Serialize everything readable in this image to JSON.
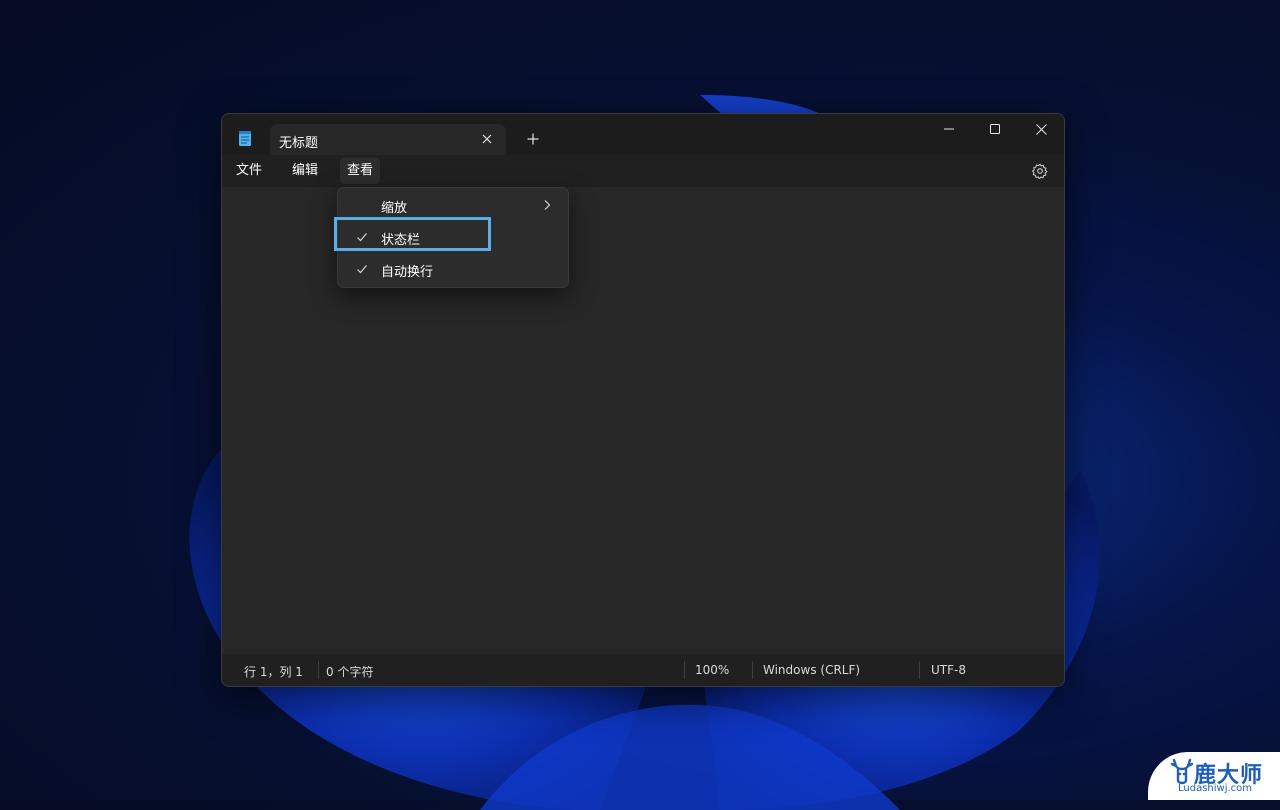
{
  "window": {
    "tab_title": "无标题",
    "icons": {
      "app": "notepad-icon",
      "tab_close": "close-icon",
      "new_tab": "plus-icon",
      "minimize": "minimize-icon",
      "maximize": "maximize-icon",
      "close": "close-icon",
      "settings": "gear-icon"
    }
  },
  "menubar": {
    "items": [
      {
        "label": "文件"
      },
      {
        "label": "编辑"
      },
      {
        "label": "查看",
        "active": true
      }
    ]
  },
  "view_menu": {
    "items": [
      {
        "label": "缩放",
        "checked": false,
        "submenu": true
      },
      {
        "label": "状态栏",
        "checked": true,
        "highlighted": true
      },
      {
        "label": "自动换行",
        "checked": true
      }
    ]
  },
  "statusbar": {
    "position": "行 1，列 1",
    "char_count": "0 个字符",
    "zoom": "100%",
    "line_ending": "Windows (CRLF)",
    "encoding": "UTF-8"
  },
  "watermark": {
    "brand": "鹿大师",
    "url": "Ludashiwj.com"
  },
  "colors": {
    "highlight_border": "#5aaee8",
    "window_bg": "#272727",
    "titlebar_bg": "#1c1c1c"
  }
}
